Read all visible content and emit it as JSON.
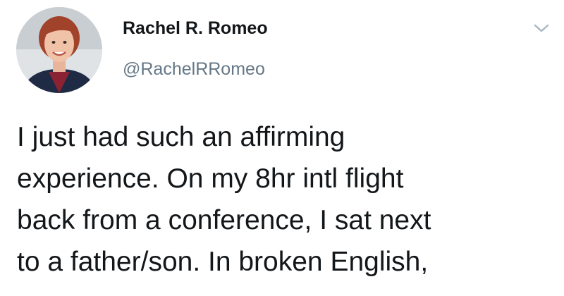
{
  "author": {
    "display_name": "Rachel R. Romeo",
    "handle": "@RachelRRomeo",
    "avatar": "profile-photo"
  },
  "menu_icon": "chevron-down-icon",
  "tweet": {
    "lines": [
      "I just had such an affirming",
      "experience. On my 8hr intl flight",
      "back from a conference, I sat next",
      "to a father/son. In broken English,"
    ]
  },
  "colors": {
    "text": "#14171a",
    "secondary_text": "#657786",
    "chevron": "#aab8c2"
  }
}
